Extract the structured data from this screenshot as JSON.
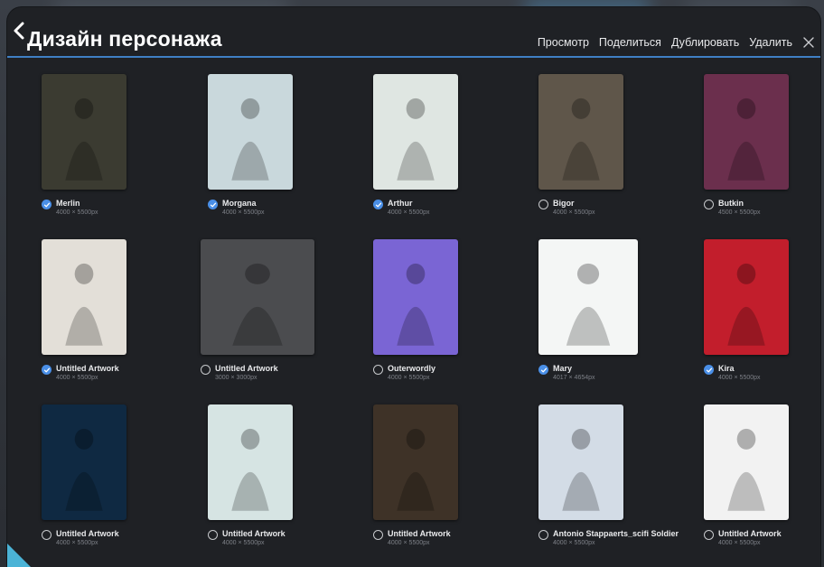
{
  "header": {
    "title": "Дизайн персонажа",
    "actions": [
      "Просмотр",
      "Поделиться",
      "Дублировать",
      "Удалить"
    ]
  },
  "artworks": [
    {
      "name": "Merlin",
      "dims": "4000 × 5500px",
      "selected": true,
      "bg": "#3b3b31"
    },
    {
      "name": "Morgana",
      "dims": "4000 × 5500px",
      "selected": true,
      "bg": "#c9d8dc"
    },
    {
      "name": "Arthur",
      "dims": "4000 × 5500px",
      "selected": true,
      "bg": "#dfe6e2"
    },
    {
      "name": "Bigor",
      "dims": "4000 × 5500px",
      "selected": false,
      "bg": "#5f564a"
    },
    {
      "name": "Butkin",
      "dims": "4500 × 5500px",
      "selected": false,
      "bg": "#6b2f4d"
    },
    {
      "name": "Untitled Artwork",
      "dims": "4000 × 5500px",
      "selected": true,
      "bg": "#e3dfd8"
    },
    {
      "name": "Untitled Artwork",
      "dims": "3000 × 3000px",
      "selected": false,
      "bg": "#4b4c4f"
    },
    {
      "name": "Outerwordly",
      "dims": "4000 × 5500px",
      "selected": false,
      "bg": "#7a65d4"
    },
    {
      "name": "Mary",
      "dims": "4017 × 4654px",
      "selected": true,
      "bg": "#f4f6f5"
    },
    {
      "name": "Kira",
      "dims": "4000 × 5500px",
      "selected": true,
      "bg": "#c21e2c"
    },
    {
      "name": "Untitled Artwork",
      "dims": "4000 × 5500px",
      "selected": false,
      "bg": "#0f2942"
    },
    {
      "name": "Untitled Artwork",
      "dims": "4000 × 5500px",
      "selected": false,
      "bg": "#d6e4e3"
    },
    {
      "name": "Untitled Artwork",
      "dims": "4000 × 5500px",
      "selected": false,
      "bg": "#3e3227"
    },
    {
      "name": "Antonio Stappaerts_scifi Soldier",
      "dims": "4000 × 5500px",
      "selected": false,
      "bg": "#d3dce6"
    },
    {
      "name": "Untitled Artwork",
      "dims": "4000 × 5500px",
      "selected": false,
      "bg": "#f2f2f2"
    }
  ],
  "icons": {
    "back": "chevron-left-icon",
    "close": "close-icon",
    "check": "checkmark-icon"
  },
  "colors": {
    "accent": "#4a8fe7",
    "background": "#1f2125",
    "header_line": "#3f7fc4"
  }
}
